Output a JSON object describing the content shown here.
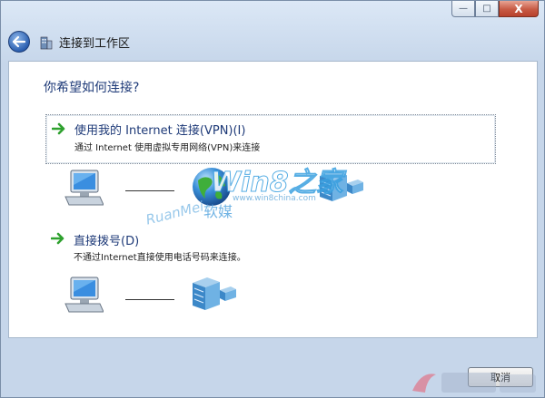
{
  "window": {
    "controls": {
      "minimize": "—",
      "maximize": "□",
      "close": "X"
    }
  },
  "header": {
    "title": "连接到工作区",
    "back_icon": "back-arrow-icon"
  },
  "main": {
    "question": "你希望如何连接?",
    "options": [
      {
        "title": "使用我的 Internet 连接(VPN)(I)",
        "description": "通过 Internet 使用虚拟专用网络(VPN)来连接",
        "icon": "green-arrow-icon"
      },
      {
        "title": "直接拨号(D)",
        "description": "不通过Internet直接使用电话号码来连接。",
        "icon": "green-arrow-icon"
      }
    ]
  },
  "watermark": {
    "brand_latin": "Win8之家",
    "url": "www.win8china.com",
    "ruanmei_latin": "RuanMei",
    "ruanmei_cn": "软媒"
  },
  "footer": {
    "cancel_label": "取消"
  },
  "colors": {
    "accent_text": "#1e3a78",
    "arrow_green": "#2fa12f",
    "watermark_blue": "#3aa0e0"
  }
}
